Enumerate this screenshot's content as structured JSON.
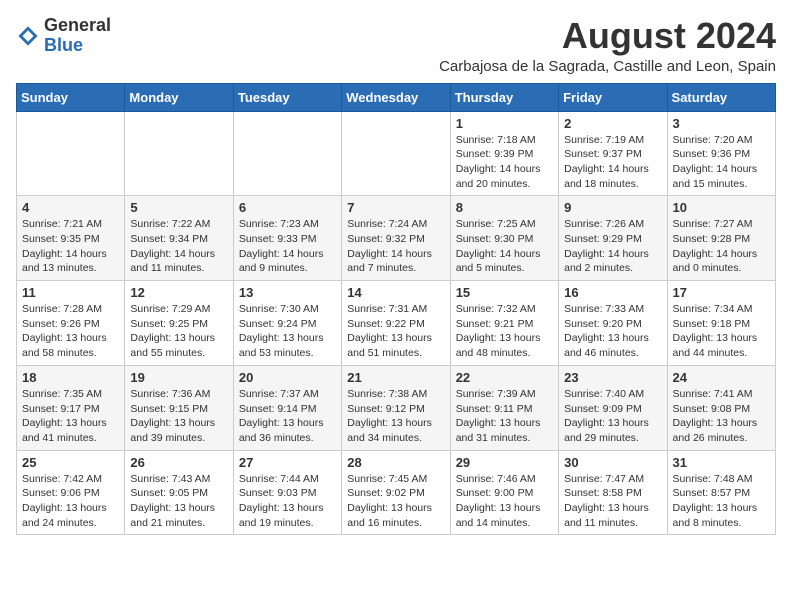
{
  "logo": {
    "general": "General",
    "blue": "Blue"
  },
  "title": "August 2024",
  "location": "Carbajosa de la Sagrada, Castille and Leon, Spain",
  "days_of_week": [
    "Sunday",
    "Monday",
    "Tuesday",
    "Wednesday",
    "Thursday",
    "Friday",
    "Saturday"
  ],
  "weeks": [
    [
      {
        "day": "",
        "info": ""
      },
      {
        "day": "",
        "info": ""
      },
      {
        "day": "",
        "info": ""
      },
      {
        "day": "",
        "info": ""
      },
      {
        "day": "1",
        "info": "Sunrise: 7:18 AM\nSunset: 9:39 PM\nDaylight: 14 hours and 20 minutes."
      },
      {
        "day": "2",
        "info": "Sunrise: 7:19 AM\nSunset: 9:37 PM\nDaylight: 14 hours and 18 minutes."
      },
      {
        "day": "3",
        "info": "Sunrise: 7:20 AM\nSunset: 9:36 PM\nDaylight: 14 hours and 15 minutes."
      }
    ],
    [
      {
        "day": "4",
        "info": "Sunrise: 7:21 AM\nSunset: 9:35 PM\nDaylight: 14 hours and 13 minutes."
      },
      {
        "day": "5",
        "info": "Sunrise: 7:22 AM\nSunset: 9:34 PM\nDaylight: 14 hours and 11 minutes."
      },
      {
        "day": "6",
        "info": "Sunrise: 7:23 AM\nSunset: 9:33 PM\nDaylight: 14 hours and 9 minutes."
      },
      {
        "day": "7",
        "info": "Sunrise: 7:24 AM\nSunset: 9:32 PM\nDaylight: 14 hours and 7 minutes."
      },
      {
        "day": "8",
        "info": "Sunrise: 7:25 AM\nSunset: 9:30 PM\nDaylight: 14 hours and 5 minutes."
      },
      {
        "day": "9",
        "info": "Sunrise: 7:26 AM\nSunset: 9:29 PM\nDaylight: 14 hours and 2 minutes."
      },
      {
        "day": "10",
        "info": "Sunrise: 7:27 AM\nSunset: 9:28 PM\nDaylight: 14 hours and 0 minutes."
      }
    ],
    [
      {
        "day": "11",
        "info": "Sunrise: 7:28 AM\nSunset: 9:26 PM\nDaylight: 13 hours and 58 minutes."
      },
      {
        "day": "12",
        "info": "Sunrise: 7:29 AM\nSunset: 9:25 PM\nDaylight: 13 hours and 55 minutes."
      },
      {
        "day": "13",
        "info": "Sunrise: 7:30 AM\nSunset: 9:24 PM\nDaylight: 13 hours and 53 minutes."
      },
      {
        "day": "14",
        "info": "Sunrise: 7:31 AM\nSunset: 9:22 PM\nDaylight: 13 hours and 51 minutes."
      },
      {
        "day": "15",
        "info": "Sunrise: 7:32 AM\nSunset: 9:21 PM\nDaylight: 13 hours and 48 minutes."
      },
      {
        "day": "16",
        "info": "Sunrise: 7:33 AM\nSunset: 9:20 PM\nDaylight: 13 hours and 46 minutes."
      },
      {
        "day": "17",
        "info": "Sunrise: 7:34 AM\nSunset: 9:18 PM\nDaylight: 13 hours and 44 minutes."
      }
    ],
    [
      {
        "day": "18",
        "info": "Sunrise: 7:35 AM\nSunset: 9:17 PM\nDaylight: 13 hours and 41 minutes."
      },
      {
        "day": "19",
        "info": "Sunrise: 7:36 AM\nSunset: 9:15 PM\nDaylight: 13 hours and 39 minutes."
      },
      {
        "day": "20",
        "info": "Sunrise: 7:37 AM\nSunset: 9:14 PM\nDaylight: 13 hours and 36 minutes."
      },
      {
        "day": "21",
        "info": "Sunrise: 7:38 AM\nSunset: 9:12 PM\nDaylight: 13 hours and 34 minutes."
      },
      {
        "day": "22",
        "info": "Sunrise: 7:39 AM\nSunset: 9:11 PM\nDaylight: 13 hours and 31 minutes."
      },
      {
        "day": "23",
        "info": "Sunrise: 7:40 AM\nSunset: 9:09 PM\nDaylight: 13 hours and 29 minutes."
      },
      {
        "day": "24",
        "info": "Sunrise: 7:41 AM\nSunset: 9:08 PM\nDaylight: 13 hours and 26 minutes."
      }
    ],
    [
      {
        "day": "25",
        "info": "Sunrise: 7:42 AM\nSunset: 9:06 PM\nDaylight: 13 hours and 24 minutes."
      },
      {
        "day": "26",
        "info": "Sunrise: 7:43 AM\nSunset: 9:05 PM\nDaylight: 13 hours and 21 minutes."
      },
      {
        "day": "27",
        "info": "Sunrise: 7:44 AM\nSunset: 9:03 PM\nDaylight: 13 hours and 19 minutes."
      },
      {
        "day": "28",
        "info": "Sunrise: 7:45 AM\nSunset: 9:02 PM\nDaylight: 13 hours and 16 minutes."
      },
      {
        "day": "29",
        "info": "Sunrise: 7:46 AM\nSunset: 9:00 PM\nDaylight: 13 hours and 14 minutes."
      },
      {
        "day": "30",
        "info": "Sunrise: 7:47 AM\nSunset: 8:58 PM\nDaylight: 13 hours and 11 minutes."
      },
      {
        "day": "31",
        "info": "Sunrise: 7:48 AM\nSunset: 8:57 PM\nDaylight: 13 hours and 8 minutes."
      }
    ]
  ]
}
